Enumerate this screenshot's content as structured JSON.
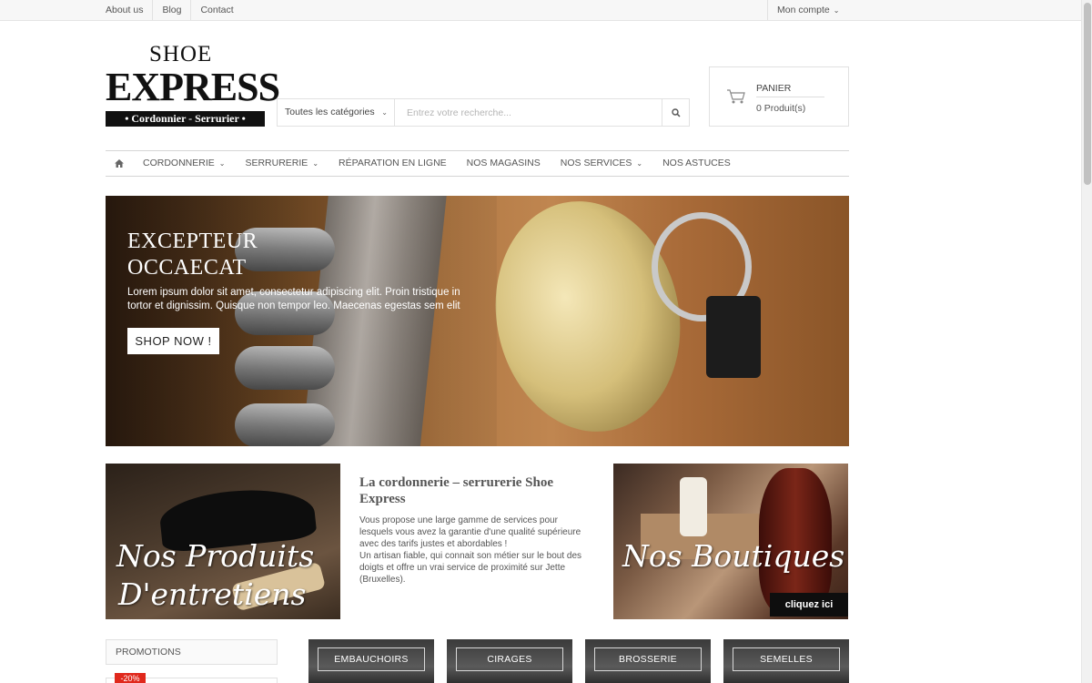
{
  "topbar": {
    "links": [
      "About us",
      "Blog",
      "Contact"
    ],
    "account_label": "Mon compte"
  },
  "logo": {
    "line1": "SHOE",
    "line2": "EXPRESS",
    "line3": "• Cordonnier - Serrurier •"
  },
  "search": {
    "category_label": "Toutes les catégories",
    "placeholder": "Entrez votre recherche..."
  },
  "cart": {
    "title": "PANIER",
    "count_text": "0 Produit(s)"
  },
  "nav": {
    "items": [
      {
        "label": "CORDONNERIE",
        "has_dropdown": true
      },
      {
        "label": "SERRURERIE",
        "has_dropdown": true
      },
      {
        "label": "RÉPARATION EN LIGNE",
        "has_dropdown": false
      },
      {
        "label": "NOS MAGASINS",
        "has_dropdown": false
      },
      {
        "label": "NOS SERVICES",
        "has_dropdown": true
      },
      {
        "label": "NOS ASTUCES",
        "has_dropdown": false
      }
    ]
  },
  "hero": {
    "title_line1": "EXCEPTEUR",
    "title_line2": "OCCAECAT",
    "text": "Lorem ipsum dolor sit amet, consectetur adipiscing elit. Proin tristique in tortor et dignissim. Quisque non tempor leo. Maecenas egestas sem elit",
    "button_label": "SHOP NOW !"
  },
  "promo_left": {
    "line1": "Nos Produits",
    "line2": "D'entretiens"
  },
  "intro": {
    "title": "La cordonnerie – serrurerie Shoe Express",
    "paragraph1": "Vous propose une large gamme de services pour lesquels vous avez la garantie d'une qualité supérieure avec des tarifs justes et abordables !",
    "paragraph2": "Un artisan fiable, qui connait son métier sur le bout des doigts et offre un vrai service de proximité sur Jette (Bruxelles)."
  },
  "promo_right": {
    "line1": "Nos Boutiques",
    "cta": "cliquez ici"
  },
  "sidebar": {
    "title": "PROMOTIONS",
    "badge": "-20%"
  },
  "categories": [
    "EMBAUCHOIRS",
    "CIRAGES",
    "BROSSERIE",
    "SEMELLES"
  ],
  "colors": {
    "badge": "#e0281c",
    "border": "#e1e1e1"
  }
}
